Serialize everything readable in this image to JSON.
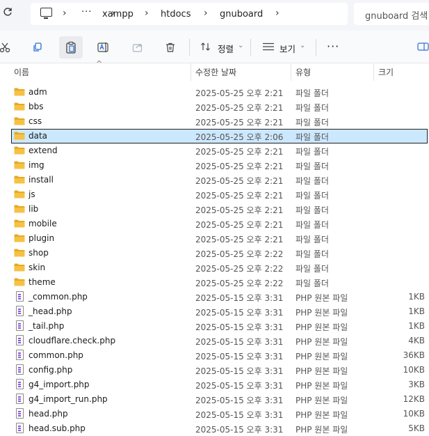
{
  "address_bar": {
    "crumbs": [
      "xampp",
      "htdocs",
      "gnuboard"
    ],
    "overflow": "···",
    "search_placeholder": "gnuboard 검색"
  },
  "toolbar": {
    "sort_label": "정렬",
    "view_label": "보기",
    "more": "···"
  },
  "columns": {
    "name": "이름",
    "date": "수정한 날짜",
    "type": "유형",
    "size": "크기"
  },
  "files": [
    {
      "name": "adm",
      "date": "2025-05-25 오후 2:21",
      "type": "파일 폴더",
      "size": "",
      "kind": "folder"
    },
    {
      "name": "bbs",
      "date": "2025-05-25 오후 2:21",
      "type": "파일 폴더",
      "size": "",
      "kind": "folder"
    },
    {
      "name": "css",
      "date": "2025-05-25 오후 2:21",
      "type": "파일 폴더",
      "size": "",
      "kind": "folder"
    },
    {
      "name": "data",
      "date": "2025-05-25 오후 2:06",
      "type": "파일 폴더",
      "size": "",
      "kind": "folder",
      "selected": true
    },
    {
      "name": "extend",
      "date": "2025-05-25 오후 2:21",
      "type": "파일 폴더",
      "size": "",
      "kind": "folder"
    },
    {
      "name": "img",
      "date": "2025-05-25 오후 2:21",
      "type": "파일 폴더",
      "size": "",
      "kind": "folder"
    },
    {
      "name": "install",
      "date": "2025-05-25 오후 2:21",
      "type": "파일 폴더",
      "size": "",
      "kind": "folder"
    },
    {
      "name": "js",
      "date": "2025-05-25 오후 2:21",
      "type": "파일 폴더",
      "size": "",
      "kind": "folder"
    },
    {
      "name": "lib",
      "date": "2025-05-25 오후 2:21",
      "type": "파일 폴더",
      "size": "",
      "kind": "folder"
    },
    {
      "name": "mobile",
      "date": "2025-05-25 오후 2:21",
      "type": "파일 폴더",
      "size": "",
      "kind": "folder"
    },
    {
      "name": "plugin",
      "date": "2025-05-25 오후 2:21",
      "type": "파일 폴더",
      "size": "",
      "kind": "folder"
    },
    {
      "name": "shop",
      "date": "2025-05-25 오후 2:22",
      "type": "파일 폴더",
      "size": "",
      "kind": "folder"
    },
    {
      "name": "skin",
      "date": "2025-05-25 오후 2:22",
      "type": "파일 폴더",
      "size": "",
      "kind": "folder"
    },
    {
      "name": "theme",
      "date": "2025-05-25 오후 2:22",
      "type": "파일 폴더",
      "size": "",
      "kind": "folder"
    },
    {
      "name": "_common.php",
      "date": "2025-05-15 오후 3:31",
      "type": "PHP 원본 파일",
      "size": "1KB",
      "kind": "php"
    },
    {
      "name": "_head.php",
      "date": "2025-05-15 오후 3:31",
      "type": "PHP 원본 파일",
      "size": "1KB",
      "kind": "php"
    },
    {
      "name": "_tail.php",
      "date": "2025-05-15 오후 3:31",
      "type": "PHP 원본 파일",
      "size": "1KB",
      "kind": "php"
    },
    {
      "name": "cloudflare.check.php",
      "date": "2025-05-15 오후 3:31",
      "type": "PHP 원본 파일",
      "size": "4KB",
      "kind": "php"
    },
    {
      "name": "common.php",
      "date": "2025-05-15 오후 3:31",
      "type": "PHP 원본 파일",
      "size": "36KB",
      "kind": "php"
    },
    {
      "name": "config.php",
      "date": "2025-05-15 오후 3:31",
      "type": "PHP 원본 파일",
      "size": "10KB",
      "kind": "php"
    },
    {
      "name": "g4_import.php",
      "date": "2025-05-15 오후 3:31",
      "type": "PHP 원본 파일",
      "size": "3KB",
      "kind": "php"
    },
    {
      "name": "g4_import_run.php",
      "date": "2025-05-15 오후 3:31",
      "type": "PHP 원본 파일",
      "size": "12KB",
      "kind": "php"
    },
    {
      "name": "head.php",
      "date": "2025-05-15 오후 3:31",
      "type": "PHP 원본 파일",
      "size": "10KB",
      "kind": "php"
    },
    {
      "name": "head.sub.php",
      "date": "2025-05-15 오후 3:31",
      "type": "PHP 원본 파일",
      "size": "5KB",
      "kind": "php"
    }
  ],
  "colors": {
    "folder": "#f5c244",
    "selection": "#cce8ff",
    "php_icon": "#8f5ad6"
  }
}
